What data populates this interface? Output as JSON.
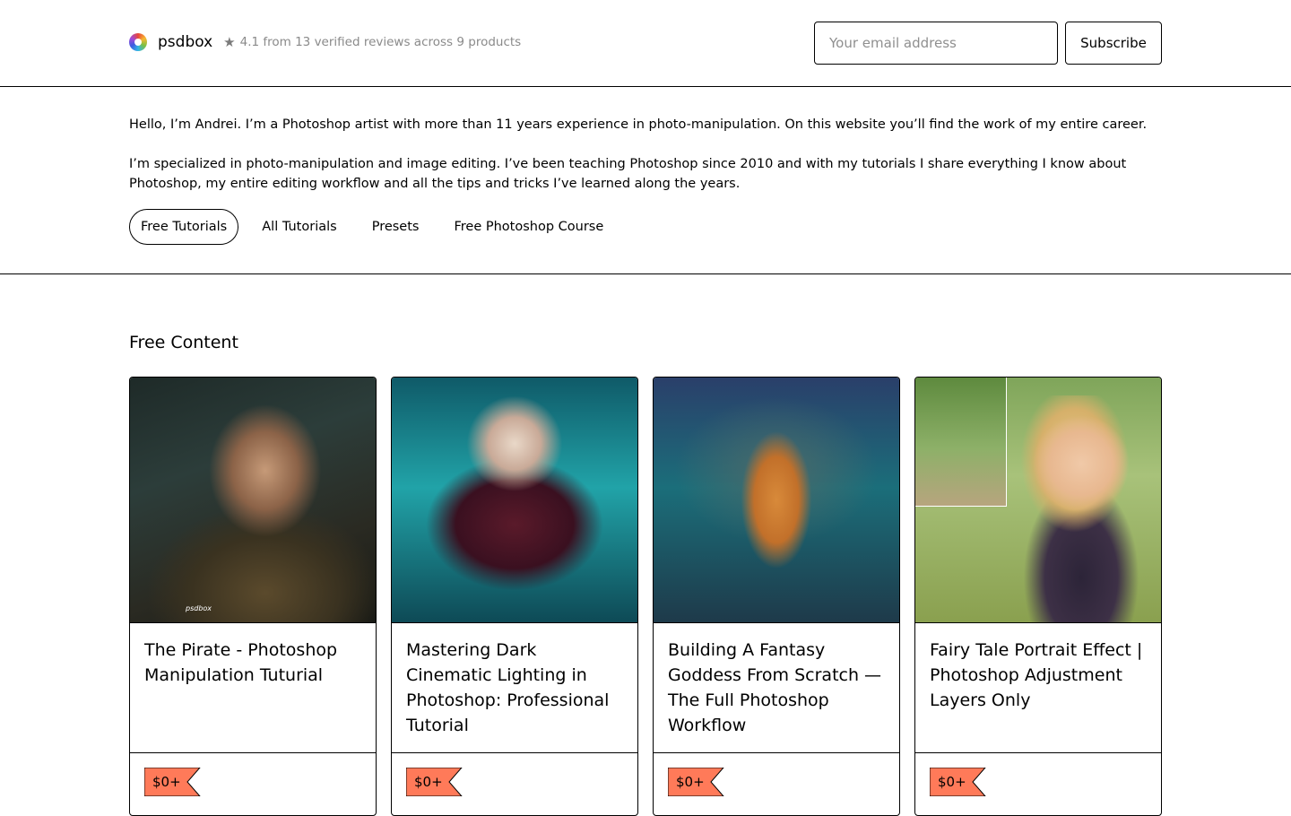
{
  "header": {
    "brand": "psdbox",
    "rating": "4.1 from 13 verified reviews across 9 products",
    "email_placeholder": "Your email address",
    "subscribe_label": "Subscribe"
  },
  "intro": {
    "paragraph1": "Hello, I’m Andrei. I’m a Photoshop artist with more than 11 years experience in photo-manipulation. On this website you’ll find the work of my entire career.",
    "paragraph2": "I’m specialized in photo-manipulation and image editing. I’ve been teaching Photoshop since 2010 and with my tutorials I share everything I know about Photoshop, my entire editing workflow and all the tips and tricks I’ve learned along the years."
  },
  "tabs": [
    {
      "label": "Free Tutorials",
      "active": true
    },
    {
      "label": "All Tutorials",
      "active": false
    },
    {
      "label": "Presets",
      "active": false
    },
    {
      "label": "Free Photoshop Course",
      "active": false
    }
  ],
  "section_title": "Free Content",
  "products": [
    {
      "title": "The Pirate - Photoshop Manipulation Tuturial",
      "price": "$0+",
      "watermark": "psdbox"
    },
    {
      "title": "Mastering Dark Cinematic Lighting in Photoshop: Professional Tutorial",
      "price": "$0+"
    },
    {
      "title": "Building A Fantasy Goddess From Scratch — The Full Photoshop Workflow",
      "price": "$0+"
    },
    {
      "title": "Fairy Tale Portrait Effect | Photoshop Adjustment Layers Only",
      "price": "$0+"
    }
  ],
  "colors": {
    "price_tag": "#ff7a59",
    "border": "#000000"
  }
}
